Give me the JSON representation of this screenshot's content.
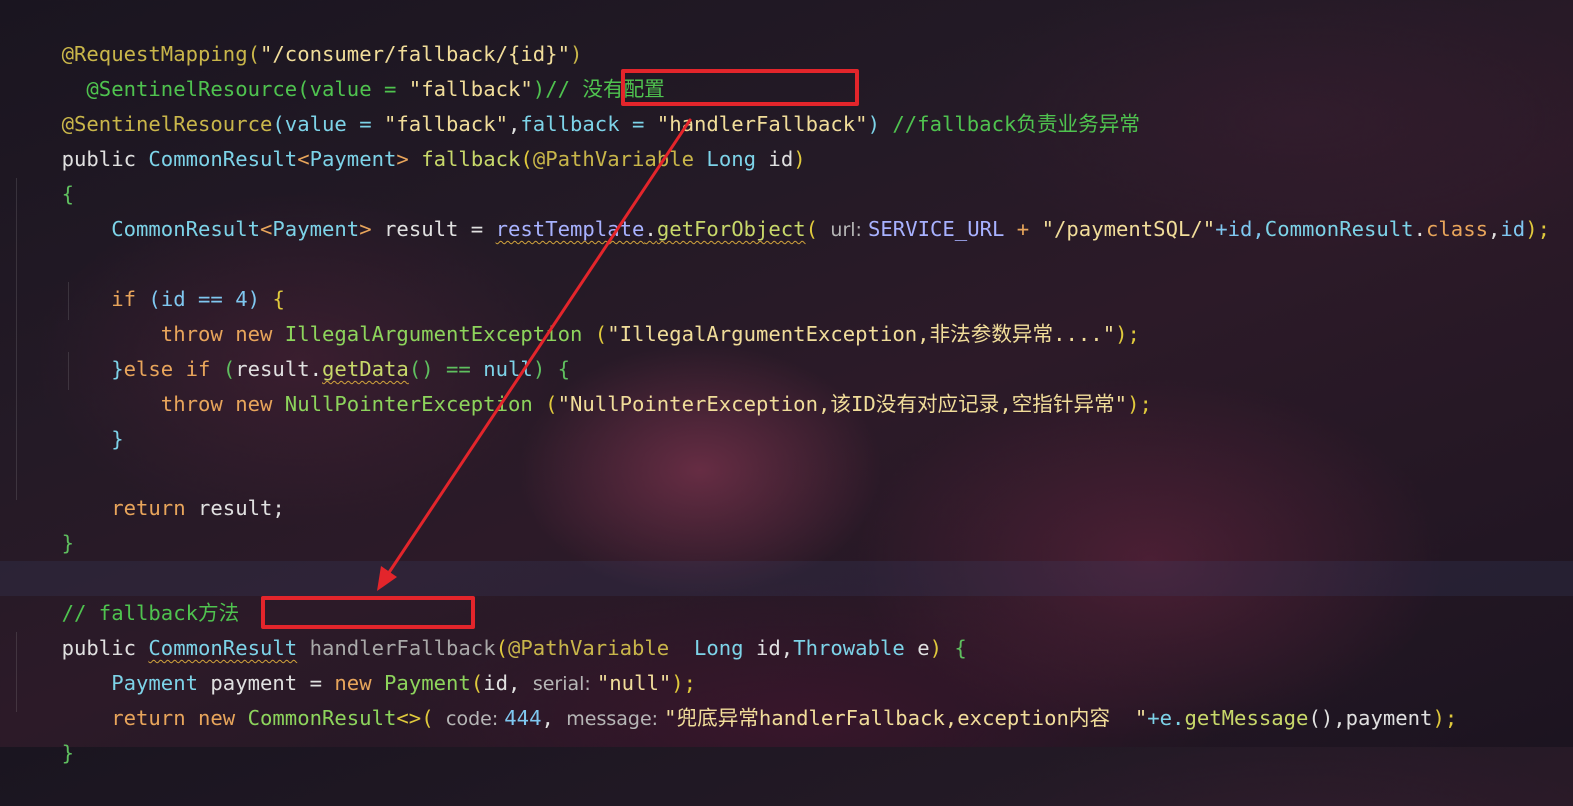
{
  "lines": {
    "l1": {
      "p1": "@RequestMapping(",
      "p2": "\"/consumer/fallback/{id}\"",
      "p3": ")"
    },
    "l2": {
      "p1": "  @SentinelResource(",
      "p2": "value = ",
      "p3": "\"fallback\"",
      "p4": ")// 没有配置"
    },
    "l3": {
      "p1": "@SentinelResource",
      "p2": "(",
      "p3": "value = ",
      "p4": "\"fallback\"",
      "p5": ",",
      "p6": "fallback = ",
      "p7": "\"handlerFallback\"",
      "p8": ")",
      "p9": " //fallback负责业务异常"
    },
    "l4": {
      "p1": "public ",
      "p2": "CommonResult",
      "p3": "<",
      "p4": "Payment",
      "p5": "> ",
      "p6": "fallback",
      "p7": "(",
      "p8": "@PathVariable",
      "p9": " Long ",
      "p10": "id",
      "p11": ")"
    },
    "l5": {
      "p1": "{"
    },
    "l6": {
      "p1": "    CommonResult",
      "p2": "<",
      "p3": "Payment",
      "p4": "> ",
      "p5": "result = ",
      "p6": "restTemplate",
      "p7": ".",
      "p8": "getForObject",
      "p9": "( ",
      "p10": "url: ",
      "p11": "SERVICE_URL",
      "p12": " + ",
      "p13": "\"/paymentSQL/\"",
      "p14": "+id,",
      "p15": "CommonResult",
      "p16": ".",
      "p17": "class",
      ",": ",",
      "p18": "id",
      ");": ");"
    },
    "l7": {
      "p1": "    if ",
      "p2": "(",
      "p3": "id == ",
      "p4": "4",
      "p5": ") ",
      "p6": "{"
    },
    "l8": {
      "p1": "        throw new ",
      "p2": "IllegalArgumentException",
      "p3": " (",
      "p4": "\"IllegalArgumentException,非法参数异常....\"",
      "p5": ");"
    },
    "l9": {
      "p1": "    }",
      "p2": "else if ",
      "p3": "(",
      "p4": "result.",
      "p5": "getData",
      "p6": "() == ",
      "p7": "null",
      "p8": ") ",
      "p9": "{"
    },
    "l10": {
      "p1": "        throw new ",
      "p2": "NullPointerException",
      "p3": " (",
      "p4": "\"NullPointerException,该ID没有对应记录,空指针异常\"",
      "p5": ");"
    },
    "l11": {
      "p1": "    }"
    },
    "l12": {
      "p1": "    return ",
      "p2": "result;"
    },
    "l13": {
      "p1": "}"
    },
    "l14": {
      "p1": "// fallback方法"
    },
    "l15": {
      "p1": "public ",
      "p2": "CommonResult",
      "p3": " ",
      "p4": "handlerFallback",
      "p5": "(",
      "p6": "@PathVariable",
      "p7": "  Long ",
      "p8": "id,",
      "p9": "Throwable ",
      "p10": "e",
      ") ": ") ",
      "p11": "{"
    },
    "l16": {
      "p1": "    Payment ",
      "p2": "payment = ",
      "p3": "new ",
      "p4": "Payment",
      "p5": "(",
      "p6": "id, ",
      "p7": "serial: ",
      "p8": "\"null\"",
      "p9": ");"
    },
    "l17": {
      "p1": "    return new ",
      "p2": "CommonResult",
      "p3": "<>( ",
      "p4": "code: ",
      "p5": "444",
      ", ": ", ",
      "p6": "message: ",
      "p7": "\"兜底异常handlerFallback,exception内容  \"",
      "p8": "+e.",
      "p9": "getMessage",
      "p10": "(),payment",
      ");": ");"
    },
    "l18": {
      "p1": "}"
    }
  },
  "colors": {
    "highlight_box": "#e3252b",
    "arrow": "#e3252b",
    "background": "#221a24"
  },
  "annotations": {
    "arrow_icon": "red-arrow-icon"
  }
}
